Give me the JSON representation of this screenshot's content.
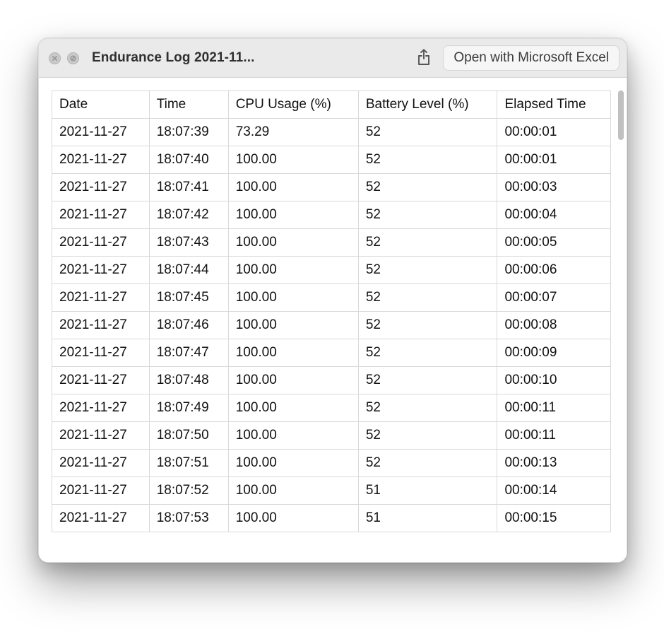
{
  "window": {
    "title": "Endurance Log 2021-11...",
    "open_with_label": "Open with Microsoft Excel"
  },
  "table": {
    "headers": [
      "Date",
      "Time",
      "CPU Usage (%)",
      "Battery Level (%)",
      "Elapsed Time"
    ],
    "rows": [
      {
        "date": "2021-11-27",
        "time": "18:07:39",
        "cpu": "73.29",
        "battery": "52",
        "elapsed": "00:00:01"
      },
      {
        "date": "2021-11-27",
        "time": "18:07:40",
        "cpu": "100.00",
        "battery": "52",
        "elapsed": "00:00:01"
      },
      {
        "date": "2021-11-27",
        "time": "18:07:41",
        "cpu": "100.00",
        "battery": "52",
        "elapsed": "00:00:03"
      },
      {
        "date": "2021-11-27",
        "time": "18:07:42",
        "cpu": "100.00",
        "battery": "52",
        "elapsed": "00:00:04"
      },
      {
        "date": "2021-11-27",
        "time": "18:07:43",
        "cpu": "100.00",
        "battery": "52",
        "elapsed": "00:00:05"
      },
      {
        "date": "2021-11-27",
        "time": "18:07:44",
        "cpu": "100.00",
        "battery": "52",
        "elapsed": "00:00:06"
      },
      {
        "date": "2021-11-27",
        "time": "18:07:45",
        "cpu": "100.00",
        "battery": "52",
        "elapsed": "00:00:07"
      },
      {
        "date": "2021-11-27",
        "time": "18:07:46",
        "cpu": "100.00",
        "battery": "52",
        "elapsed": "00:00:08"
      },
      {
        "date": "2021-11-27",
        "time": "18:07:47",
        "cpu": "100.00",
        "battery": "52",
        "elapsed": "00:00:09"
      },
      {
        "date": "2021-11-27",
        "time": "18:07:48",
        "cpu": "100.00",
        "battery": "52",
        "elapsed": "00:00:10"
      },
      {
        "date": "2021-11-27",
        "time": "18:07:49",
        "cpu": "100.00",
        "battery": "52",
        "elapsed": "00:00:11"
      },
      {
        "date": "2021-11-27",
        "time": "18:07:50",
        "cpu": "100.00",
        "battery": "52",
        "elapsed": "00:00:11"
      },
      {
        "date": "2021-11-27",
        "time": "18:07:51",
        "cpu": "100.00",
        "battery": "52",
        "elapsed": "00:00:13"
      },
      {
        "date": "2021-11-27",
        "time": "18:07:52",
        "cpu": "100.00",
        "battery": "51",
        "elapsed": "00:00:14"
      },
      {
        "date": "2021-11-27",
        "time": "18:07:53",
        "cpu": "100.00",
        "battery": "51",
        "elapsed": "00:00:15"
      }
    ]
  }
}
